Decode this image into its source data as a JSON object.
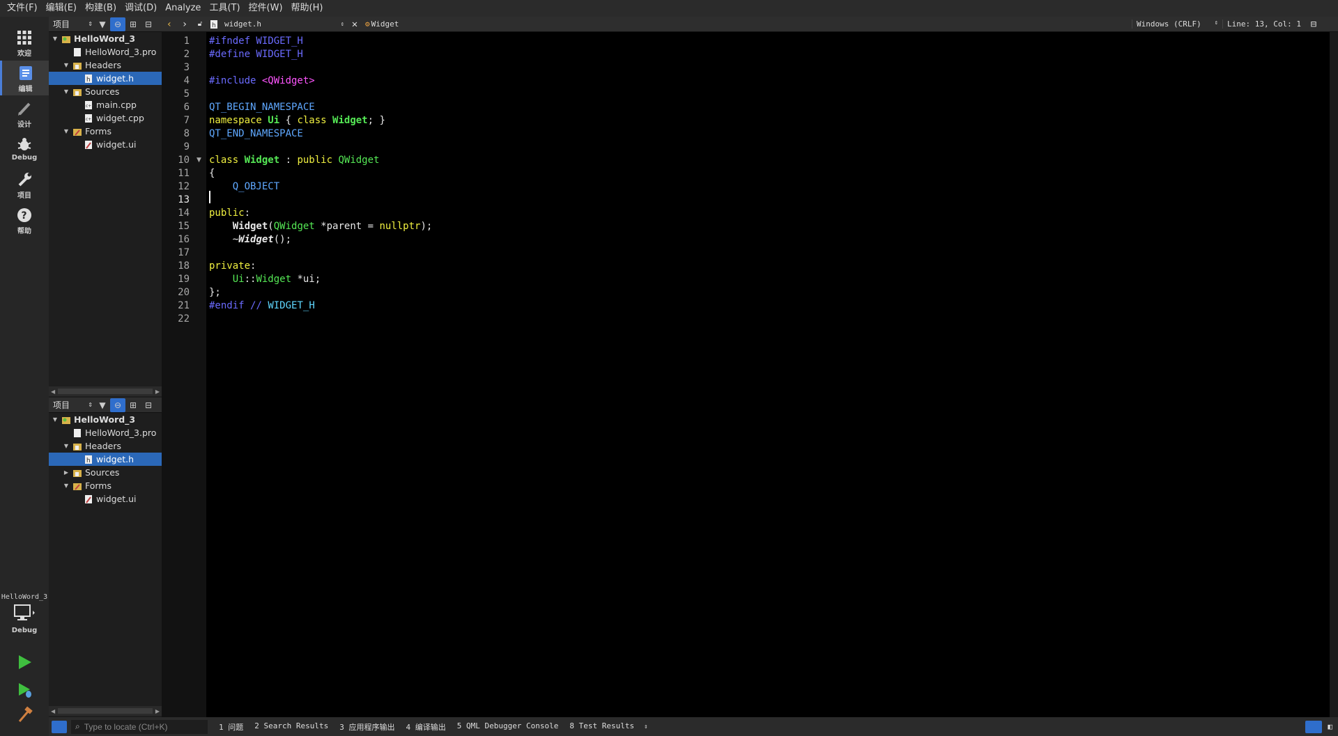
{
  "menubar": {
    "items": [
      "文件(F)",
      "编辑(E)",
      "构建(B)",
      "调试(D)",
      "Analyze",
      "工具(T)",
      "控件(W)",
      "帮助(H)"
    ]
  },
  "modes": [
    {
      "label": "欢迎",
      "icon": "grid-icon"
    },
    {
      "label": "编辑",
      "icon": "edit-doc-icon"
    },
    {
      "label": "设计",
      "icon": "pencil-icon"
    },
    {
      "label": "Debug",
      "icon": "bug-icon"
    },
    {
      "label": "项目",
      "icon": "wrench-icon"
    },
    {
      "label": "帮助",
      "icon": "help-icon"
    }
  ],
  "kit": {
    "project": "HelloWord_3",
    "mode": "Debug"
  },
  "panes": [
    {
      "selector": "项目",
      "tree": [
        {
          "name": "HelloWord_3",
          "depth": 0,
          "expanded": true,
          "icon": "project-icon",
          "bold": true
        },
        {
          "name": "HelloWord_3.pro",
          "depth": 1,
          "icon": "pro-file-icon"
        },
        {
          "name": "Headers",
          "depth": 1,
          "expanded": true,
          "icon": "folder-icon"
        },
        {
          "name": "widget.h",
          "depth": 2,
          "icon": "header-file-icon",
          "selected": true
        },
        {
          "name": "Sources",
          "depth": 1,
          "expanded": true,
          "icon": "folder-icon"
        },
        {
          "name": "main.cpp",
          "depth": 2,
          "icon": "cpp-file-icon"
        },
        {
          "name": "widget.cpp",
          "depth": 2,
          "icon": "cpp-file-icon"
        },
        {
          "name": "Forms",
          "depth": 1,
          "expanded": true,
          "icon": "forms-folder-icon"
        },
        {
          "name": "widget.ui",
          "depth": 2,
          "icon": "ui-file-icon"
        }
      ]
    },
    {
      "selector": "项目",
      "tree": [
        {
          "name": "HelloWord_3",
          "depth": 0,
          "expanded": true,
          "icon": "project-icon",
          "bold": true
        },
        {
          "name": "HelloWord_3.pro",
          "depth": 1,
          "icon": "pro-file-icon"
        },
        {
          "name": "Headers",
          "depth": 1,
          "expanded": true,
          "icon": "folder-icon"
        },
        {
          "name": "widget.h",
          "depth": 2,
          "icon": "header-file-icon",
          "selected": true
        },
        {
          "name": "Sources",
          "depth": 1,
          "expanded": false,
          "icon": "folder-icon"
        },
        {
          "name": "Forms",
          "depth": 1,
          "expanded": true,
          "icon": "forms-folder-icon"
        },
        {
          "name": "widget.ui",
          "depth": 2,
          "icon": "ui-file-icon"
        }
      ]
    }
  ],
  "editor": {
    "document": "widget.h",
    "symbol": "Widget",
    "encoding": "Windows (CRLF)",
    "position": "Line: 13, Col: 1",
    "current_line": 13,
    "lines": [
      [
        [
          "pp",
          "#ifndef WIDGET_H"
        ]
      ],
      [
        [
          "pp",
          "#define WIDGET_H"
        ]
      ],
      [],
      [
        [
          "pp",
          "#include "
        ],
        [
          "inc",
          "<QWidget>"
        ]
      ],
      [],
      [
        [
          "mac",
          "QT_BEGIN_NAMESPACE"
        ]
      ],
      [
        [
          "kw",
          "namespace "
        ],
        [
          "ty",
          "Ui"
        ],
        [
          "op",
          " { "
        ],
        [
          "kw",
          "class "
        ],
        [
          "ty",
          "Widget"
        ],
        [
          "op",
          "; }"
        ]
      ],
      [
        [
          "mac",
          "QT_END_NAMESPACE"
        ]
      ],
      [],
      [
        [
          "kw",
          "class "
        ],
        [
          "ty",
          "Widget"
        ],
        [
          "op",
          " : "
        ],
        [
          "kw",
          "public "
        ],
        [
          "cls",
          "QWidget"
        ]
      ],
      [
        [
          "op",
          "{"
        ]
      ],
      [
        [
          "op",
          "    "
        ],
        [
          "mac",
          "Q_OBJECT"
        ]
      ],
      [],
      [
        [
          "kw",
          "public"
        ],
        [
          "op",
          ":"
        ]
      ],
      [
        [
          "op",
          "    "
        ],
        [
          "fn",
          "Widget"
        ],
        [
          "op",
          "("
        ],
        [
          "cls",
          "QWidget"
        ],
        [
          "op",
          " *parent = "
        ],
        [
          "kw",
          "nullptr"
        ],
        [
          "op",
          ");"
        ]
      ],
      [
        [
          "op",
          "    ~"
        ],
        [
          "fni",
          "Widget"
        ],
        [
          "op",
          "();"
        ]
      ],
      [],
      [
        [
          "kw",
          "private"
        ],
        [
          "op",
          ":"
        ]
      ],
      [
        [
          "op",
          "    "
        ],
        [
          "cls",
          "Ui"
        ],
        [
          "op",
          "::"
        ],
        [
          "cls",
          "Widget"
        ],
        [
          "op",
          " *ui;"
        ]
      ],
      [
        [
          "op",
          "};"
        ]
      ],
      [
        [
          "pp",
          "#endif "
        ],
        [
          "cm",
          "// "
        ],
        [
          "cmm",
          "WIDGET_H"
        ]
      ],
      []
    ]
  },
  "statusbar": {
    "locator_placeholder": "Type to locate (Ctrl+K)",
    "tabs": [
      "1 问题",
      "2 Search Results",
      "3 应用程序输出",
      "4 编译输出",
      "5 QML Debugger Console",
      "8 Test Results"
    ]
  }
}
